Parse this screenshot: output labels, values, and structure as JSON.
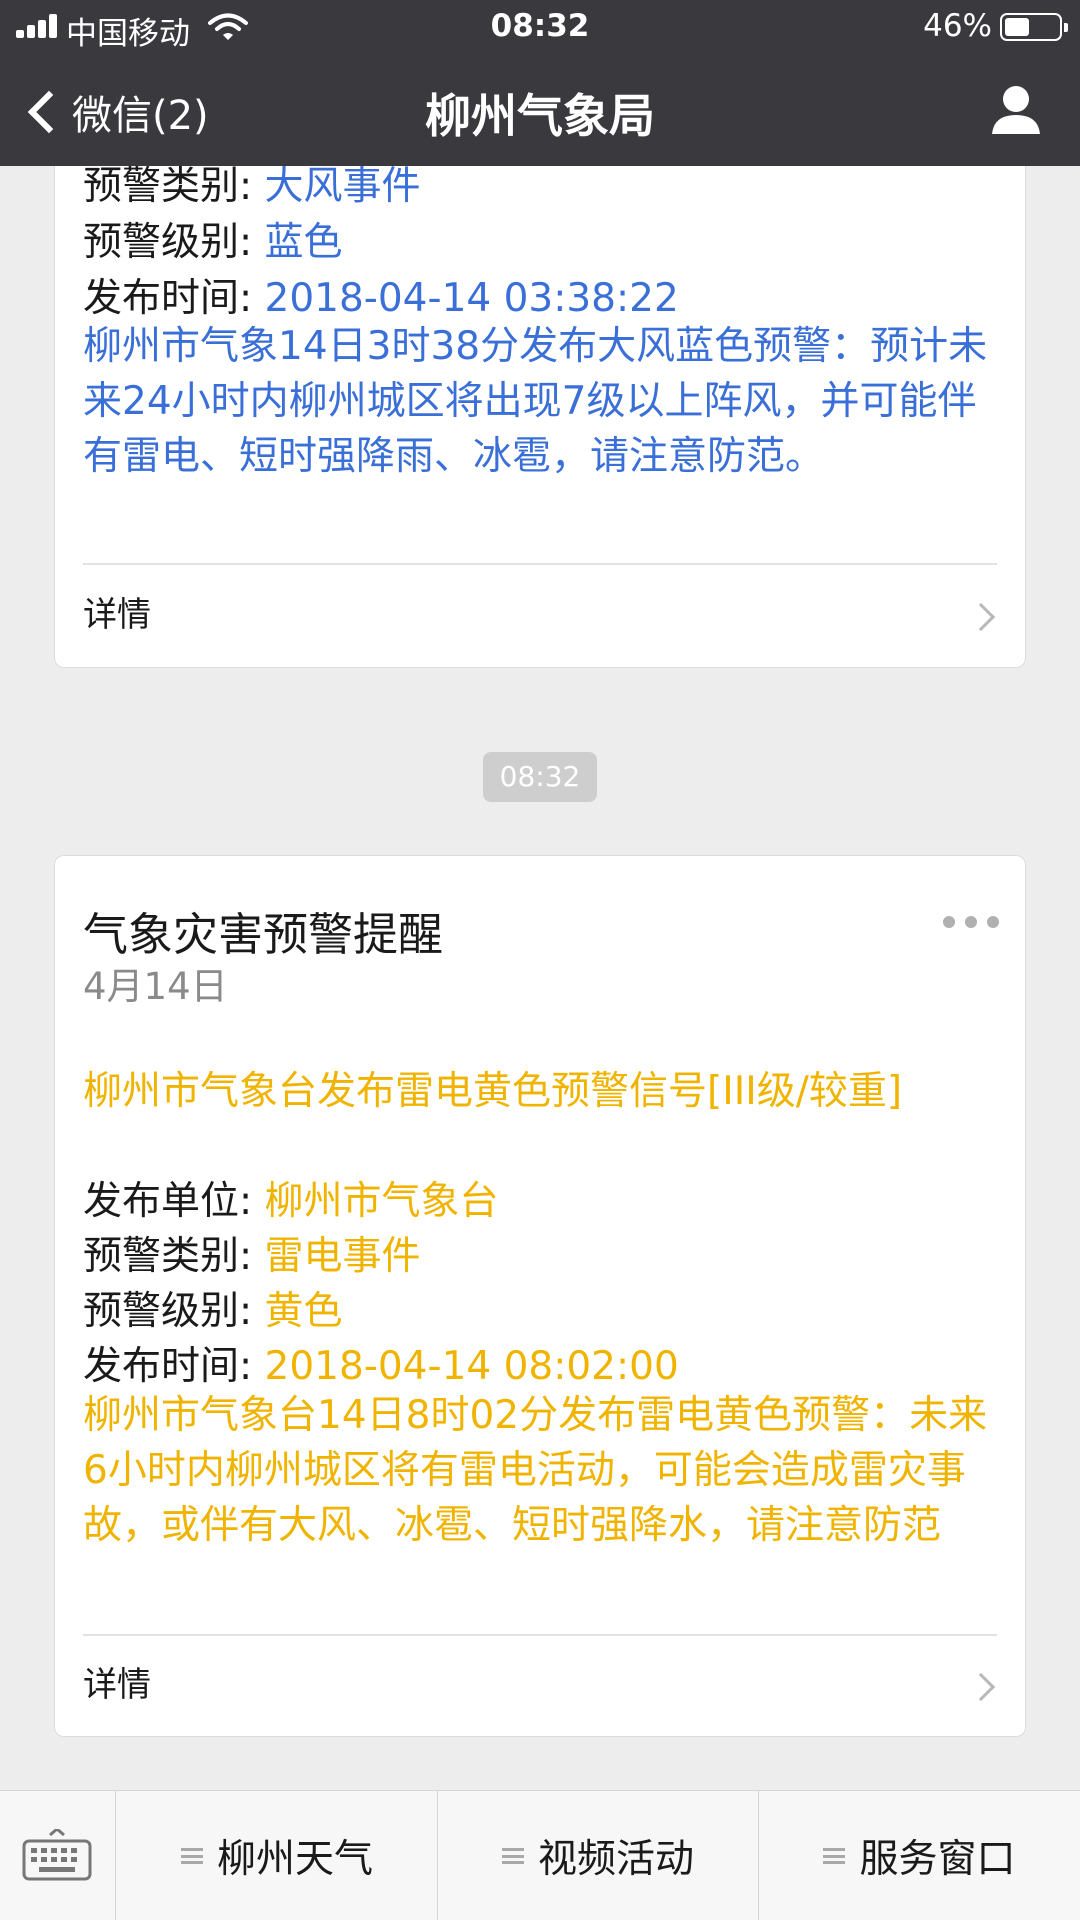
{
  "status_bar": {
    "carrier": "中国移动",
    "time": "08:32",
    "battery_percent": "46%",
    "battery_level": 0.46
  },
  "nav": {
    "back_label": "微信(2)",
    "title": "柳州气象局"
  },
  "card1": {
    "rows": [
      {
        "label": "预警类别:",
        "value": "大风事件"
      },
      {
        "label": "预警级别:",
        "value": "蓝色"
      },
      {
        "label": "发布时间:",
        "value": "2018-04-14 03:38:22"
      }
    ],
    "message": "柳州市气象14日3时38分发布大风蓝色预警：预计未来24小时内柳州城区将出现7级以上阵风，并可能伴有雷电、短时强降雨、冰雹，请注意防范。",
    "detail_label": "详情",
    "accent_color": "#3a6fd8"
  },
  "timestamp_chip": "08:32",
  "card2": {
    "title": "气象灾害预警提醒",
    "date": "4月14日",
    "headline": "柳州市气象台发布雷电黄色预警信号[III级/较重]",
    "rows": [
      {
        "label": "发布单位:",
        "value": "柳州市气象台"
      },
      {
        "label": "预警类别:",
        "value": "雷电事件"
      },
      {
        "label": "预警级别:",
        "value": "黄色"
      },
      {
        "label": "发布时间:",
        "value": "2018-04-14 08:02:00"
      }
    ],
    "message": "柳州市气象台14日8时02分发布雷电黄色预警：未来6小时内柳州城区将有雷电活动，可能会造成雷灾事故，或伴有大风、冰雹、短时强降水，请注意防范",
    "detail_label": "详情",
    "accent_color": "#f0b400"
  },
  "bottom_menu": {
    "items": [
      "柳州天气",
      "视频活动",
      "服务窗口"
    ]
  }
}
